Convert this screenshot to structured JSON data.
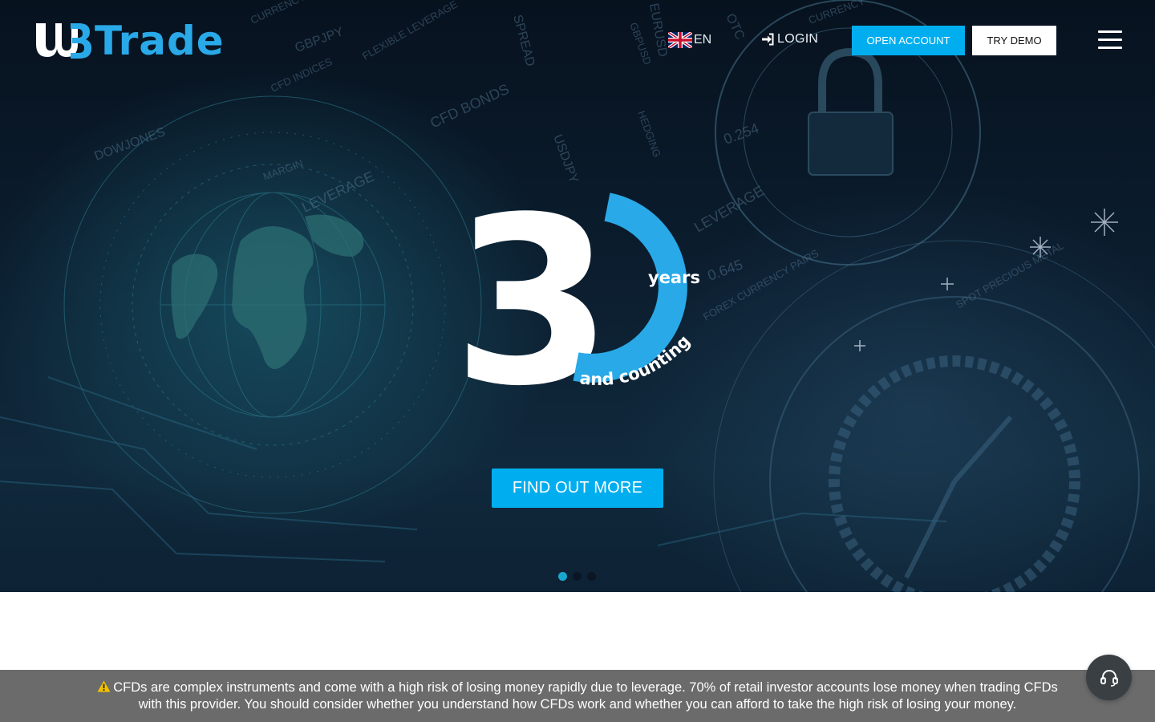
{
  "brand": {
    "name": "Trade",
    "accent": "#29a9e8"
  },
  "header": {
    "language": {
      "code": "EN",
      "flag": "uk-flag-icon"
    },
    "login_label": "LOGIN",
    "open_account_label": "OPEN ACCOUNT",
    "try_demo_label": "TRY DEMO"
  },
  "hero": {
    "number": "30",
    "years_label": "years",
    "tagline": "and counting",
    "cta_label": "FIND OUT MORE",
    "slides_total": 3,
    "active_slide": 1
  },
  "background_words": [
    "GBPJPY",
    "FLEXIBLE LEVERAGE",
    "SPREAD",
    "CURRENCY",
    "CFD BONDS",
    "CFD INDICES",
    "DOWJONES",
    "MARGIN",
    "USDJPY",
    "LEVERAGE",
    "HEDGING",
    "0.254",
    "0.645",
    "FOREX CURRENCY PAIRS",
    "SPOT PRECIOUS METAL",
    "OTC",
    "EURUSD",
    "GBPUSD",
    "CURRENCY",
    "LEVERAGE"
  ],
  "risk_warning": {
    "line1": "CFDs are complex instruments and come with a high risk of losing money rapidly due to leverage. 70% of retail investor accounts lose money when trading CFDs",
    "line2": "with this provider. You should consider whether you understand how CFDs work and whether you can afford to take the high risk of losing your money."
  },
  "colors": {
    "primary_button": "#00aeef",
    "risk_bar": "#6b6b6b",
    "support_button": "#3a3f44"
  }
}
